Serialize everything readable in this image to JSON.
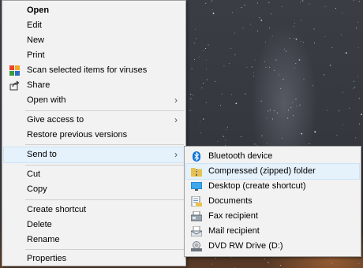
{
  "context_menu": {
    "items": [
      {
        "label": "Open"
      },
      {
        "label": "Edit"
      },
      {
        "label": "New"
      },
      {
        "label": "Print"
      },
      {
        "label": "Scan selected items for viruses",
        "icon": "antivirus-icon"
      },
      {
        "label": "Share",
        "icon": "share-icon"
      },
      {
        "label": "Open with"
      },
      {
        "label": "Give access to"
      },
      {
        "label": "Restore previous versions"
      },
      {
        "label": "Send to"
      },
      {
        "label": "Cut"
      },
      {
        "label": "Copy"
      },
      {
        "label": "Create shortcut"
      },
      {
        "label": "Delete"
      },
      {
        "label": "Rename"
      },
      {
        "label": "Properties"
      }
    ],
    "submenu_arrow": "›"
  },
  "send_to_menu": {
    "items": [
      {
        "label": "Bluetooth device",
        "icon": "bluetooth-icon"
      },
      {
        "label": "Compressed (zipped) folder",
        "icon": "zip-folder-icon"
      },
      {
        "label": "Desktop (create shortcut)",
        "icon": "desktop-icon"
      },
      {
        "label": "Documents",
        "icon": "documents-icon"
      },
      {
        "label": "Fax recipient",
        "icon": "fax-icon"
      },
      {
        "label": "Mail recipient",
        "icon": "mail-icon"
      },
      {
        "label": "DVD RW Drive (D:)",
        "icon": "dvd-drive-icon"
      }
    ]
  },
  "colors": {
    "menu_background": "#f2f2f2",
    "highlight": "#e5f1fb",
    "bluetooth": "#0a73d9",
    "desktop_icon": "#1e8ad6"
  }
}
